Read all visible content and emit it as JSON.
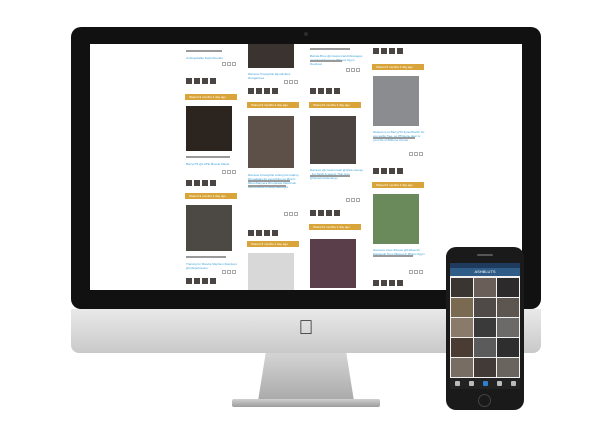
{
  "imac": {
    "logo_icon": "apple-logo",
    "feed": {
      "accent_color": "#d9a53a",
      "link_color": "#3aa1d6",
      "columns": [
        {
          "cards": [
            {
              "caption": "Unforgettable Fight Rounds",
              "bar": "Shared 9 months 1 day ago"
            },
            {
              "caption": "Barry279 @LUPE Muscle Mania",
              "bar": "Shared 9 months 1 day ago"
            },
            {
              "caption": "Training for Muscle Mayhem #workout @robinjohnsons",
              "bar": ""
            }
          ]
        },
        {
          "cards": [
            {
              "caption": "#iamuse #muaythai #goodvibes #magazines",
              "bar": "Shared 9 months 1 day ago"
            },
            {
              "caption": "#iamuse #muaythai cutting the baking #mupdates for everything go #harm #thai #tanpera #mupdatet #tattsman #atha #arkal #muaythaiweight",
              "bar": "Shared 9 months 1 day ago"
            },
            {
              "caption": "",
              "bar": ""
            }
          ]
        },
        {
          "cards": [
            {
              "caption": "Barista Bros @crossrunnard Messages Amazing Weapons #fitness #gym #workout",
              "bar": "Shared 9 months 1 day ago"
            },
            {
              "caption": "#iamuse @crossrunwell @olivia cauxay - Ins Ssick & seeing Thai prep @lanterpixelamangu",
              "bar": "Shared 9 months 1 day ago"
            },
            {
              "caption": "",
              "bar": ""
            }
          ]
        },
        {
          "cards": [
            {
              "caption": "",
              "bar": "Shared 9 months 1 day ago"
            },
            {
              "caption": "#welcome to Barry279 #yourWorld! So you sarfer free, so #Tiitsune dear to your life of #fitbone #xmas",
              "bar": "Shared 9 months 1 day ago"
            },
            {
              "caption": "Harmuze Aces #house @Fabworld #tatsaugh #yoc #fitsupply #fitspo #gym",
              "bar": ""
            }
          ]
        }
      ]
    }
  },
  "iphone": {
    "title": "ASHBLUTS",
    "grid_tiles": 15,
    "tabs": [
      "home-icon",
      "search-icon",
      "camera-icon",
      "activity-icon",
      "profile-icon"
    ],
    "active_tab": 2
  }
}
